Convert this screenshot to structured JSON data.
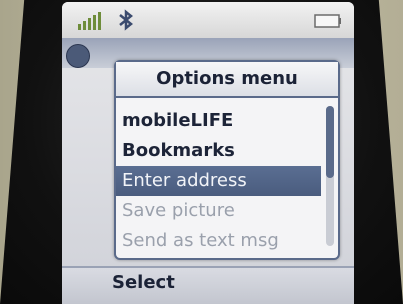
{
  "status_bar": {
    "signal_icon": "signal-strength-icon",
    "bluetooth_icon": "bluetooth-icon",
    "battery_icon": "battery-icon"
  },
  "options_menu": {
    "title": "Options menu",
    "items": [
      {
        "label": "mobileLIFE",
        "state": "enabled"
      },
      {
        "label": "Bookmarks",
        "state": "enabled"
      },
      {
        "label": "Enter address",
        "state": "selected"
      },
      {
        "label": "Save picture",
        "state": "disabled"
      },
      {
        "label": "Send as text msg",
        "state": "disabled"
      }
    ],
    "scroll_position": 0.0
  },
  "softkeys": {
    "left": "Select"
  },
  "colors": {
    "selection": "#4f6286",
    "dialog_border": "#5a6a8a",
    "disabled_text": "#9aa0ac"
  }
}
